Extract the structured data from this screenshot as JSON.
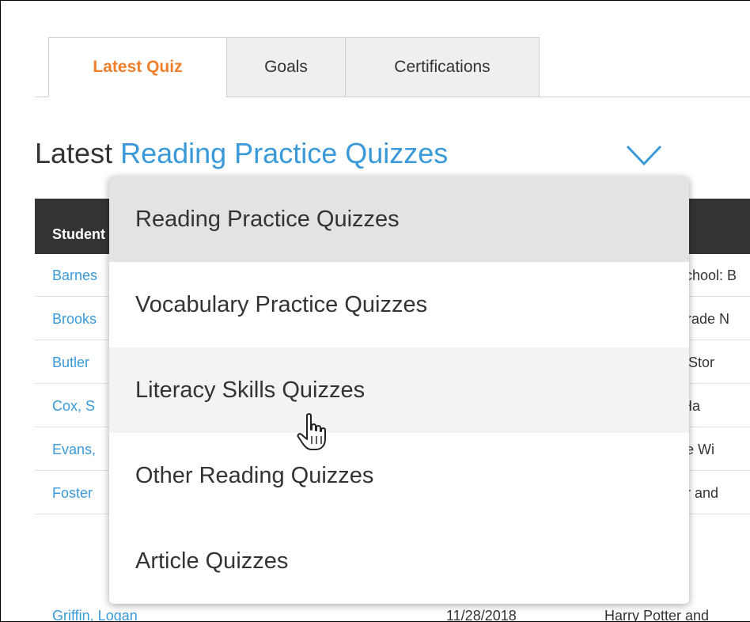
{
  "tabs": [
    {
      "label": "Latest Quiz",
      "active": true
    },
    {
      "label": "Goals",
      "active": false
    },
    {
      "label": "Certifications",
      "active": false
    }
  ],
  "heading": {
    "prefix": "Latest ",
    "selected_type": "Reading Practice Quizzes",
    "toggle_icon": "chevron-down-icon"
  },
  "table": {
    "header_student": "Student",
    "rows": [
      {
        "student": "Barnes",
        "date": "",
        "title": "School: B"
      },
      {
        "student": "Brooks",
        "date": "",
        "title": "Grade N"
      },
      {
        "student": "Butler",
        "date": "",
        "title": "of Stor"
      },
      {
        "student": "Cox, S",
        "date": "",
        "title": "-Ha"
      },
      {
        "student": "Evans,",
        "date": "",
        "title": "the Wi"
      },
      {
        "student": "Foster",
        "date": "",
        "title": "ter and"
      },
      {
        "student": "Griffin, Logan",
        "date": "11/28/2018",
        "title": "Harry Potter and"
      }
    ]
  },
  "dropdown": {
    "options": [
      {
        "label": "Reading Practice Quizzes",
        "state": "selected"
      },
      {
        "label": "Vocabulary Practice Quizzes",
        "state": "normal"
      },
      {
        "label": "Literacy Skills Quizzes",
        "state": "hover"
      },
      {
        "label": "Other Reading Quizzes",
        "state": "normal"
      },
      {
        "label": "Article Quizzes",
        "state": "normal"
      }
    ]
  },
  "colors": {
    "accent_orange": "#f07f2a",
    "link_blue": "#3a9ad9",
    "header_dark": "#333333"
  }
}
